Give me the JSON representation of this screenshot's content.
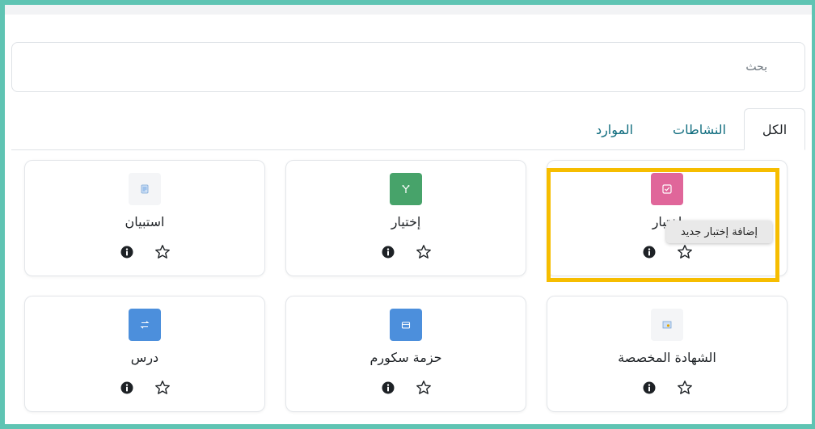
{
  "search": {
    "placeholder": "بحث"
  },
  "tabs": [
    {
      "label": "الكل",
      "active": true
    },
    {
      "label": "النشاطات",
      "active": false
    },
    {
      "label": "الموارد",
      "active": false
    }
  ],
  "cards": [
    {
      "label": "اختبار",
      "icon": "quiz-icon",
      "color": "#e0669a"
    },
    {
      "label": "إختيار",
      "icon": "choice-icon",
      "color": "#47a36a"
    },
    {
      "label": "استبيان",
      "icon": "feedback-icon",
      "color": "#f4f5f7"
    },
    {
      "label": "الشهادة المخصصة",
      "icon": "certificate-icon",
      "color": "#f4f5f7"
    },
    {
      "label": "حزمة سكورم",
      "icon": "scorm-icon",
      "color": "#4c8fdc"
    },
    {
      "label": "درس",
      "icon": "lesson-icon",
      "color": "#4c8fdc"
    }
  ],
  "tooltip": {
    "text": "إضافة إختبار جديد"
  },
  "colors": {
    "frame": "#5fc4b3",
    "highlight": "#f6bd00",
    "link": "#0f6c7e"
  }
}
